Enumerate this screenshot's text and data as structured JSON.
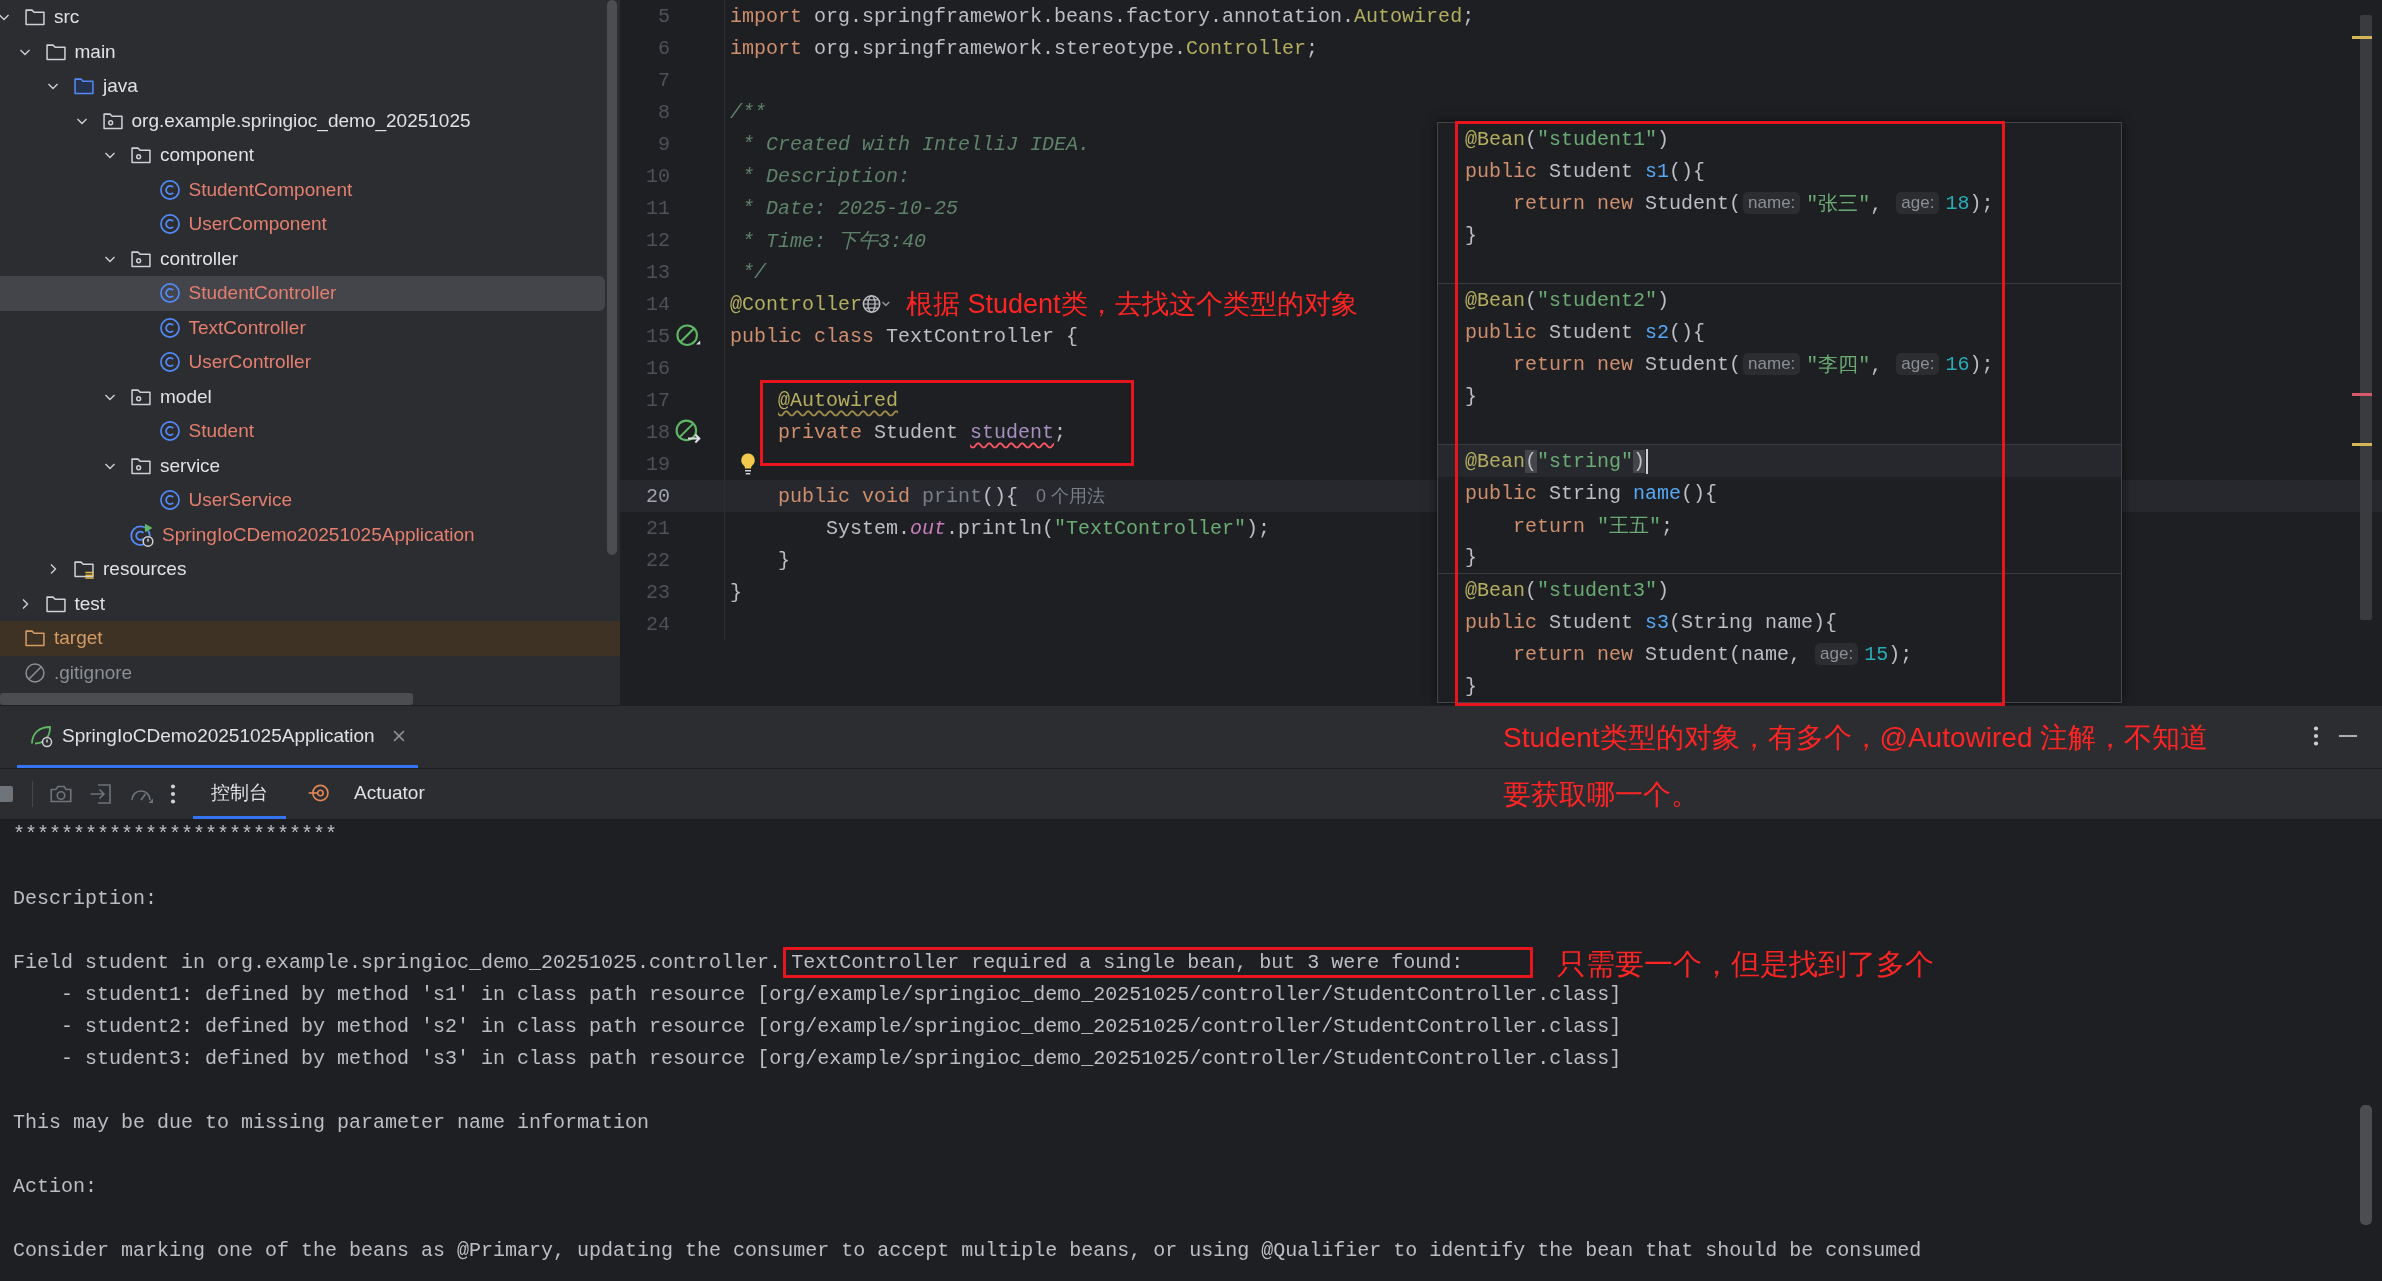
{
  "project_tree": [
    {
      "label": "src",
      "kind": "folder",
      "expanded": true,
      "selected": false,
      "children": [
        {
          "label": "main",
          "kind": "folder",
          "expanded": true,
          "selected": false,
          "children": [
            {
              "label": "java",
              "kind": "source-root",
              "expanded": true,
              "selected": false,
              "children": [
                {
                  "label": "org.example.springioc_demo_20251025",
                  "kind": "package",
                  "expanded": true,
                  "selected": false,
                  "children": [
                    {
                      "label": "component",
                      "kind": "package",
                      "expanded": true,
                      "selected": false,
                      "children": [
                        {
                          "label": "StudentComponent",
                          "kind": "class",
                          "selected": false
                        },
                        {
                          "label": "UserComponent",
                          "kind": "class",
                          "selected": false
                        }
                      ]
                    },
                    {
                      "label": "controller",
                      "kind": "package",
                      "expanded": true,
                      "selected": false,
                      "children": [
                        {
                          "label": "StudentController",
                          "kind": "class",
                          "selected": true
                        },
                        {
                          "label": "TextController",
                          "kind": "class",
                          "selected": false
                        },
                        {
                          "label": "UserController",
                          "kind": "class",
                          "selected": false
                        }
                      ]
                    },
                    {
                      "label": "model",
                      "kind": "package",
                      "expanded": true,
                      "selected": false,
                      "children": [
                        {
                          "label": "Student",
                          "kind": "class",
                          "selected": false
                        }
                      ]
                    },
                    {
                      "label": "service",
                      "kind": "package",
                      "expanded": true,
                      "selected": false,
                      "children": [
                        {
                          "label": "UserService",
                          "kind": "class",
                          "selected": false
                        }
                      ]
                    },
                    {
                      "label": "SpringIoCDemo20251025Application",
                      "kind": "app-class",
                      "selected": false
                    }
                  ]
                }
              ]
            },
            {
              "label": "resources",
              "kind": "resources-root",
              "expanded": false,
              "selected": false
            }
          ]
        },
        {
          "label": "test",
          "kind": "folder",
          "expanded": false,
          "selected": false
        }
      ]
    },
    {
      "label": "target",
      "kind": "excluded-folder",
      "selected": false
    },
    {
      "label": ".gitignore",
      "kind": "ignored-file",
      "selected": false
    }
  ],
  "editor": {
    "lines": [
      {
        "number": "5",
        "current": false,
        "tokens": [
          {
            "kind": "keyword",
            "text": "import"
          },
          {
            "kind": "plain",
            "text": " org.springframework.beans.factory.annotation."
          },
          {
            "kind": "annotation",
            "text": "Autowired"
          },
          {
            "kind": "plain",
            "text": ";"
          }
        ]
      },
      {
        "number": "6",
        "current": false,
        "tokens": [
          {
            "kind": "keyword",
            "text": "import"
          },
          {
            "kind": "plain",
            "text": " org.springframework.stereotype."
          },
          {
            "kind": "annotation",
            "text": "Controller"
          },
          {
            "kind": "plain",
            "text": ";"
          }
        ]
      },
      {
        "number": "7",
        "current": false
      },
      {
        "number": "8",
        "current": false,
        "tokens": [
          {
            "kind": "comment",
            "text": "/**"
          }
        ]
      },
      {
        "number": "9",
        "current": false,
        "tokens": [
          {
            "kind": "comment",
            "text": " * Created with IntelliJ IDEA."
          }
        ]
      },
      {
        "number": "10",
        "current": false,
        "tokens": [
          {
            "kind": "comment",
            "text": " * Description:"
          }
        ]
      },
      {
        "number": "11",
        "current": false,
        "tokens": [
          {
            "kind": "comment",
            "text": " * Date: 2025-10-25"
          }
        ]
      },
      {
        "number": "12",
        "current": false,
        "tokens": [
          {
            "kind": "comment",
            "text": " * Time: 下午3:40"
          }
        ]
      },
      {
        "number": "13",
        "current": false,
        "tokens": [
          {
            "kind": "comment",
            "text": " */"
          }
        ]
      },
      {
        "number": "14",
        "current": false,
        "tokens": [
          {
            "kind": "annotation",
            "text": "@Controller"
          },
          {
            "kind": "web-inlay"
          }
        ]
      },
      {
        "number": "15",
        "current": false,
        "gutter": {
          "kind": "bean"
        },
        "tokens": [
          {
            "kind": "keyword",
            "text": "public"
          },
          {
            "kind": "keyword",
            "text": " class"
          },
          {
            "kind": "plain",
            "text": " TextController {"
          }
        ]
      },
      {
        "number": "16",
        "current": false
      },
      {
        "number": "17",
        "current": false,
        "tokens": [
          {
            "kind": "annotation-warning",
            "text": "    @Autowired"
          }
        ]
      },
      {
        "number": "18",
        "current": false,
        "gutter": {
          "kind": "bean-inject"
        },
        "tokens": [
          {
            "kind": "keyword",
            "text": "    private"
          },
          {
            "kind": "plain",
            "text": " Student "
          },
          {
            "kind": "field-error",
            "text": "student"
          },
          {
            "kind": "plain",
            "text": ";"
          }
        ]
      },
      {
        "number": "19",
        "current": false,
        "gutter": {
          "kind": "bulb"
        }
      },
      {
        "number": "20",
        "current": true,
        "tokens": [
          {
            "kind": "keyword",
            "text": "    public"
          },
          {
            "kind": "keyword",
            "text": " void"
          },
          {
            "kind": "unused",
            "text": " print"
          },
          {
            "kind": "plain",
            "text": "(){"
          },
          {
            "kind": "usage",
            "text": "0 个用法"
          }
        ]
      },
      {
        "number": "21",
        "current": false,
        "tokens": [
          {
            "kind": "plain",
            "text": "        System."
          },
          {
            "kind": "static",
            "text": "out"
          },
          {
            "kind": "plain",
            "text": ".println("
          },
          {
            "kind": "string",
            "text": "\"TextController\""
          },
          {
            "kind": "plain",
            "text": ");"
          }
        ]
      },
      {
        "number": "22",
        "current": false,
        "tokens": [
          {
            "kind": "plain",
            "text": "    }"
          }
        ]
      },
      {
        "number": "23",
        "current": false,
        "tokens": [
          {
            "kind": "plain",
            "text": "}"
          }
        ]
      },
      {
        "number": "24",
        "current": false
      }
    ],
    "popup": {
      "sections": [
        {
          "lines": [
            {
              "current": false,
              "tokens": [
                {
                  "kind": "annotation",
                  "text": "@Bean"
                },
                {
                  "kind": "plain",
                  "text": "("
                },
                {
                  "kind": "string",
                  "text": "\"student1\""
                },
                {
                  "kind": "plain",
                  "text": ")"
                }
              ]
            },
            {
              "current": false,
              "tokens": [
                {
                  "kind": "keyword",
                  "text": "public"
                },
                {
                  "kind": "plain",
                  "text": " Student "
                },
                {
                  "kind": "method",
                  "text": "s1"
                },
                {
                  "kind": "plain",
                  "text": "(){"
                }
              ]
            },
            {
              "current": false,
              "tokens": [
                {
                  "kind": "keyword",
                  "text": "    return"
                },
                {
                  "kind": "keyword",
                  "text": " new"
                },
                {
                  "kind": "plain",
                  "text": " Student("
                },
                {
                  "kind": "hint",
                  "text": "name:"
                },
                {
                  "kind": "string",
                  "text": "\"张三\""
                },
                {
                  "kind": "plain",
                  "text": ", "
                },
                {
                  "kind": "hint",
                  "text": "age:"
                },
                {
                  "kind": "number",
                  "text": "18"
                },
                {
                  "kind": "plain",
                  "text": ");"
                }
              ]
            },
            {
              "current": false,
              "tokens": [
                {
                  "kind": "plain",
                  "text": "}"
                }
              ]
            },
            {
              "current": false
            }
          ]
        },
        {
          "lines": [
            {
              "current": false,
              "tokens": [
                {
                  "kind": "annotation",
                  "text": "@Bean"
                },
                {
                  "kind": "plain",
                  "text": "("
                },
                {
                  "kind": "string",
                  "text": "\"student2\""
                },
                {
                  "kind": "plain",
                  "text": ")"
                }
              ]
            },
            {
              "current": false,
              "tokens": [
                {
                  "kind": "keyword",
                  "text": "public"
                },
                {
                  "kind": "plain",
                  "text": " Student "
                },
                {
                  "kind": "method",
                  "text": "s2"
                },
                {
                  "kind": "plain",
                  "text": "(){"
                }
              ]
            },
            {
              "current": false,
              "tokens": [
                {
                  "kind": "keyword",
                  "text": "    return"
                },
                {
                  "kind": "keyword",
                  "text": " new"
                },
                {
                  "kind": "plain",
                  "text": " Student("
                },
                {
                  "kind": "hint",
                  "text": "name:"
                },
                {
                  "kind": "string",
                  "text": "\"李四\""
                },
                {
                  "kind": "plain",
                  "text": ", "
                },
                {
                  "kind": "hint",
                  "text": "age:"
                },
                {
                  "kind": "number",
                  "text": "16"
                },
                {
                  "kind": "plain",
                  "text": ");"
                }
              ]
            },
            {
              "current": false,
              "tokens": [
                {
                  "kind": "plain",
                  "text": "}"
                }
              ]
            },
            {
              "current": false
            }
          ]
        },
        {
          "lines": [
            {
              "current": true,
              "tokens": [
                {
                  "kind": "annotation",
                  "text": "@Bean"
                },
                {
                  "kind": "bracket",
                  "text": "("
                },
                {
                  "kind": "string",
                  "text": "\"string\""
                },
                {
                  "kind": "bracket",
                  "text": ")"
                },
                {
                  "kind": "caret"
                }
              ]
            },
            {
              "current": false,
              "tokens": [
                {
                  "kind": "keyword",
                  "text": "public"
                },
                {
                  "kind": "plain",
                  "text": " String "
                },
                {
                  "kind": "method",
                  "text": "name"
                },
                {
                  "kind": "plain",
                  "text": "(){"
                }
              ]
            },
            {
              "current": false,
              "tokens": [
                {
                  "kind": "keyword",
                  "text": "    return"
                },
                {
                  "kind": "string",
                  "text": " \"王五\""
                },
                {
                  "kind": "plain",
                  "text": ";"
                }
              ]
            },
            {
              "current": false,
              "tokens": [
                {
                  "kind": "plain",
                  "text": "}"
                }
              ]
            }
          ]
        },
        {
          "lines": [
            {
              "current": false,
              "tokens": [
                {
                  "kind": "annotation",
                  "text": "@Bean"
                },
                {
                  "kind": "plain",
                  "text": "("
                },
                {
                  "kind": "string",
                  "text": "\"student3\""
                },
                {
                  "kind": "plain",
                  "text": ")"
                }
              ]
            },
            {
              "current": false,
              "tokens": [
                {
                  "kind": "keyword",
                  "text": "public"
                },
                {
                  "kind": "plain",
                  "text": " Student "
                },
                {
                  "kind": "method",
                  "text": "s3"
                },
                {
                  "kind": "plain",
                  "text": "(String name){"
                }
              ]
            },
            {
              "current": false,
              "tokens": [
                {
                  "kind": "keyword",
                  "text": "    return"
                },
                {
                  "kind": "keyword",
                  "text": " new"
                },
                {
                  "kind": "plain",
                  "text": " Student(name, "
                },
                {
                  "kind": "hint",
                  "text": "age:"
                },
                {
                  "kind": "number",
                  "text": "15"
                },
                {
                  "kind": "plain",
                  "text": ");"
                }
              ]
            },
            {
              "current": false,
              "tokens": [
                {
                  "kind": "plain",
                  "text": "}"
                }
              ]
            }
          ]
        }
      ]
    }
  },
  "tool_window": {
    "tabs": [
      {
        "label": "SpringIoCDemo20251025Application",
        "selected": true
      }
    ],
    "console_tabs": [
      {
        "label": "控制台",
        "kind": "console",
        "selected": true
      },
      {
        "label": "Actuator",
        "kind": "actuator",
        "selected": false
      }
    ],
    "console_blocks": [
      {
        "lines": [
          "***************************"
        ]
      },
      {
        "lines": [
          "Description:"
        ]
      },
      {
        "lines": [
          {
            "segments": [
              {
                "text": "Field student in org.example.springioc_demo_20251025.controller.",
                "highlighted": false
              },
              {
                "text": "TextController required a single bean, but 3 were found:",
                "highlighted": true
              }
            ]
          },
          "\t- student1: defined by method 's1' in class path resource [org/example/springioc_demo_20251025/controller/StudentController.class]",
          "\t- student2: defined by method 's2' in class path resource [org/example/springioc_demo_20251025/controller/StudentController.class]",
          "\t- student3: defined by method 's3' in class path resource [org/example/springioc_demo_20251025/controller/StudentController.class]"
        ]
      },
      {
        "lines": [
          "This may be due to missing parameter name information"
        ]
      },
      {
        "lines": [
          "Action:"
        ]
      },
      {
        "lines": [
          "Consider marking one of the beans as @Primary, updating the consumer to accept multiple beans, or using @Qualifier to identify the bean that should be consumed"
        ]
      }
    ]
  },
  "annotations": [
    {
      "text": "根据 Student类，去找这个类型的对象"
    },
    {
      "text": "Student类型的对象，有多个，@Autowired 注解，不知道"
    },
    {
      "text": "要获取哪一个。"
    },
    {
      "text": "只需要一个，但是找到了多个"
    }
  ]
}
